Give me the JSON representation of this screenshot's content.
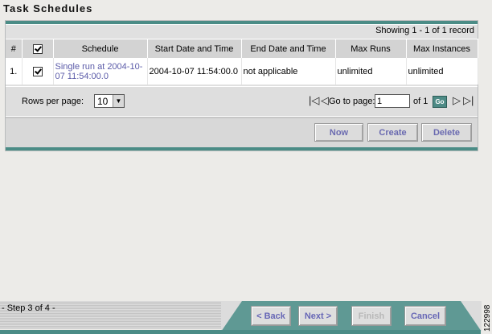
{
  "page": {
    "title": "Task Schedules"
  },
  "table": {
    "showing": "Showing 1 - 1 of 1 record",
    "headers": [
      "#",
      "",
      "Schedule",
      "Start Date and Time",
      "End Date and Time",
      "Max Runs",
      "Max Instances"
    ],
    "rows": [
      {
        "num": "1.",
        "checked": true,
        "schedule": "Single run at 2004-10-07 11:54:00.0",
        "start": "2004-10-07 11:54:00.0",
        "end": "not applicable",
        "max_runs": "unlimited",
        "max_instances": "unlimited"
      }
    ]
  },
  "pager": {
    "rows_label": "Rows per page:",
    "rows_value": "10",
    "goto_label": "Go to page:",
    "goto_value": "1",
    "of_label": "of 1",
    "go_label": "Go"
  },
  "actions": {
    "now": "Now",
    "create": "Create",
    "delete": "Delete"
  },
  "wizard": {
    "step": "- Step 3 of 4 -",
    "back": "< Back",
    "next": "Next >",
    "finish": "Finish",
    "cancel": "Cancel"
  },
  "figure_id": "122998",
  "colors": {
    "accent": "#4b8c86",
    "link": "#5a5aa8",
    "button_text": "#6a6ab0"
  }
}
